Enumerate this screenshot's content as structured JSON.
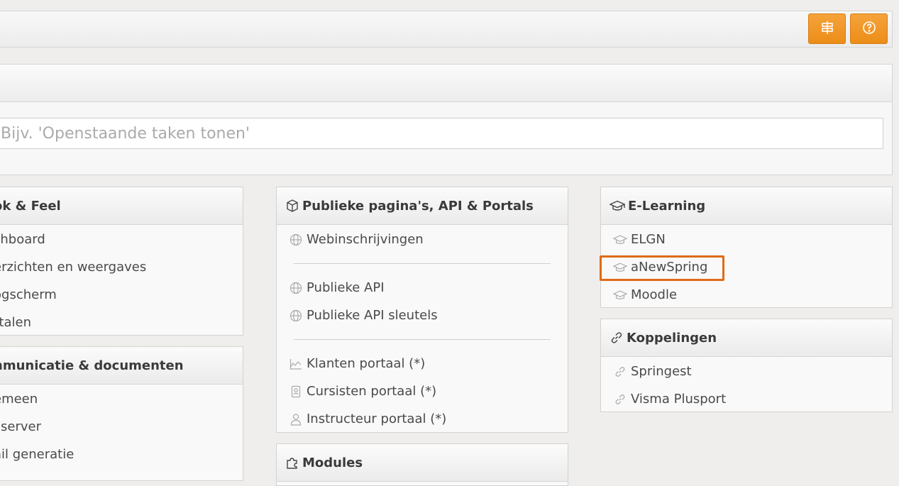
{
  "toolbar": {
    "buttons": [
      {
        "icon": "signpost-icon"
      },
      {
        "icon": "help-icon"
      }
    ],
    "accent": "#ef9424"
  },
  "search": {
    "placeholder": "Bijv. 'Openstaande taken tonen'"
  },
  "look_feel": {
    "title": "ok & Feel",
    "items": [
      "shboard",
      "erzichten en weergaves",
      "ogscherm",
      "rtalen"
    ]
  },
  "communicatie": {
    "title": "nmunicatie & documenten",
    "items": [
      "emeen",
      "ilserver",
      "ail generatie"
    ]
  },
  "publiek": {
    "title": "Publieke pagina's, API & Portals",
    "group1": [
      "Webinschrijvingen"
    ],
    "group2": [
      "Publieke API",
      "Publieke API sleutels"
    ],
    "group3": [
      "Klanten portaal (*)",
      "Cursisten portaal (*)",
      "Instructeur portaal (*)"
    ]
  },
  "modules": {
    "title": "Modules"
  },
  "elearning": {
    "title": "E-Learning",
    "items": [
      "ELGN",
      "aNewSpring",
      "Moodle"
    ],
    "highlight_color": "#e06a16"
  },
  "koppelingen": {
    "title": "Koppelingen",
    "items": [
      "Springest",
      "Visma Plusport"
    ]
  }
}
